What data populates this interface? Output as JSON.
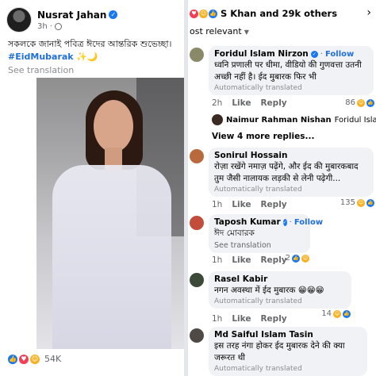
{
  "post": {
    "author": "Nusrat Jahan",
    "time": "3h",
    "text": "সকলকে জানাই পবিত্র ঈদের আন্তরিক শুভেচ্ছা।",
    "hashtag": "#EidMubarak",
    "hashtag_emoji": "✨🌙",
    "see_translation": "See translation",
    "reaction_count": "54K"
  },
  "comments_panel": {
    "reactors": "S Khan and 29k others",
    "sort_label": "ost relevant",
    "comments": [
      {
        "name": "Foridul Islam Nirzon",
        "verified": true,
        "follow": "Follow",
        "text": "ध्वनि प्रणाली पर धीमा, वीडियो की गुणवत्ता उतनी अच्छी नहीं है। ईद मुबारक फिर भी",
        "auto": "Automatically translated",
        "time": "2h",
        "like": "Like",
        "reply": "Reply",
        "reactions": "86"
      },
      {
        "name": "Sonirul Hossain",
        "text": "रोज़ा रखेंगे नमाज़ पढ़ेंगे, और ईद की मुबारकबाद तुम जैसी नालायक लड़की से लेनी पढ़ेगी...",
        "auto": "Automatically translated",
        "time": "1h",
        "like": "Like",
        "reply": "Reply",
        "reactions": "135"
      },
      {
        "name": "Taposh Kumar",
        "verified": true,
        "follow": "Follow",
        "text": "ঈদ মোবারক",
        "see_translation": "See translation",
        "time": "1h",
        "like": "Like",
        "reply": "Reply",
        "reactions": "2"
      },
      {
        "name": "Rasel Kabir",
        "text": "नगन अवस्था में ईद मुबारक 😁😁😁",
        "auto": "Automatically translated",
        "time": "1h",
        "like": "Like",
        "reply": "Reply",
        "reactions": "14"
      },
      {
        "name": "Md Saiful Islam Tasin",
        "text": "इस तरह नंगा होकर ईद मुबारक देने की क्या जरूरत थी",
        "auto": "Automatically translated",
        "time": "",
        "like": "",
        "reply": "",
        "reactions": ""
      }
    ],
    "reply": {
      "name": "Naimur Rahman Nishan",
      "reply_to": "Foridul Islam Nirzo"
    },
    "view_more": "View 4 more replies..."
  }
}
